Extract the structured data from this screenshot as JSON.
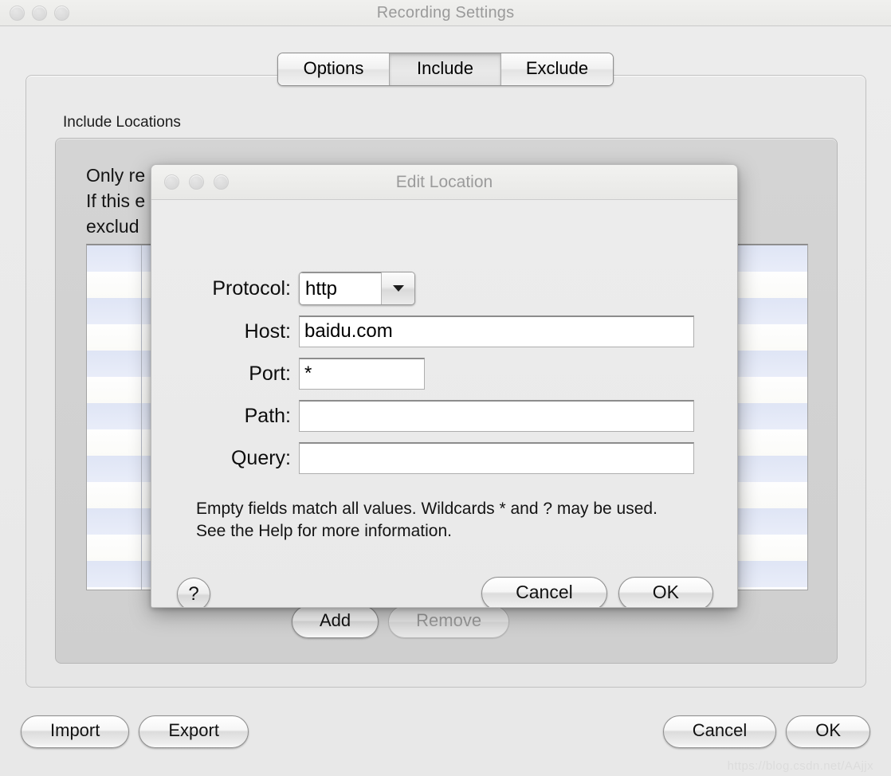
{
  "window": {
    "title": "Recording Settings",
    "traffic_lights": [
      "close",
      "minimize",
      "zoom"
    ]
  },
  "tabs": [
    {
      "label": "Options",
      "selected": false
    },
    {
      "label": "Include",
      "selected": true
    },
    {
      "label": "Exclude",
      "selected": false
    }
  ],
  "include_panel": {
    "group_label": "Include Locations",
    "description_line1": "Only re                                                                                         ded.",
    "description_line2": "If this                                                                                              e",
    "description_line3": "exclud",
    "table": {
      "row_count": 14,
      "rows": []
    },
    "add_label": "Add",
    "remove_label": "Remove",
    "remove_enabled": false
  },
  "bottom_bar": {
    "import_label": "Import",
    "export_label": "Export",
    "cancel_label": "Cancel",
    "ok_label": "OK"
  },
  "watermark": "https://blog.csdn.net/AAjjx",
  "dialog": {
    "title": "Edit Location",
    "fields": {
      "protocol": {
        "label": "Protocol:",
        "value": "http",
        "type": "popup"
      },
      "host": {
        "label": "Host:",
        "value": "baidu.com",
        "placeholder": ""
      },
      "port": {
        "label": "Port:",
        "value": "*",
        "placeholder": ""
      },
      "path": {
        "label": "Path:",
        "value": "",
        "placeholder": ""
      },
      "query": {
        "label": "Query:",
        "value": "",
        "placeholder": ""
      }
    },
    "hint_line1": "Empty fields match all values. Wildcards * and ? may be used.",
    "hint_line2": "See the Help for more information.",
    "help_label": "?",
    "cancel_label": "Cancel",
    "ok_label": "OK"
  },
  "colors": {
    "window_bg": "#ececec",
    "panel_bg": "#e8e8e8",
    "inner_box_bg": "#d2d2d2",
    "stripe_blue": "#e3e8f7",
    "stripe_white": "#fdfdfb",
    "title_text": "#9a9a9a"
  }
}
